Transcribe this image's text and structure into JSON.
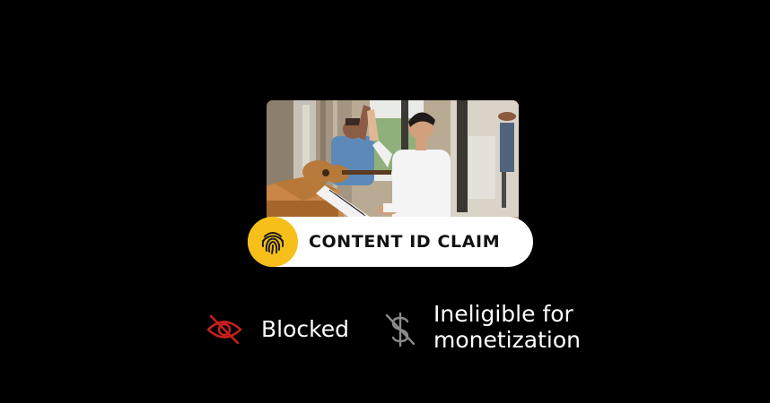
{
  "claim": {
    "label": "CONTENT ID CLAIM",
    "icon": "fingerprint-icon",
    "icon_bg": "#f6bf1a"
  },
  "statuses": [
    {
      "label": "Blocked",
      "icon": "eye-off-icon",
      "icon_color": "#cc1f1f"
    },
    {
      "label_line1": "Ineligible for",
      "label_line2": "monetization",
      "icon": "dollar-off-icon",
      "icon_color": "#8a8a8a"
    }
  ],
  "thumbnail": {
    "description_icon": "video-thumbnail"
  }
}
